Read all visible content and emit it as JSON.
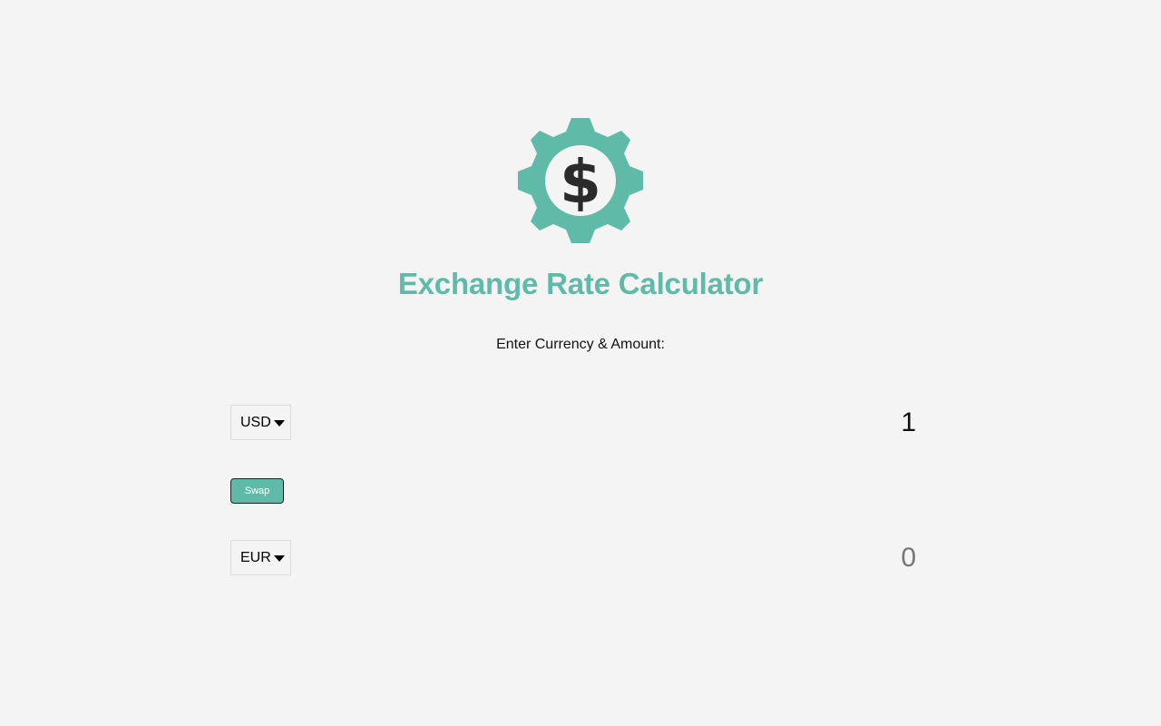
{
  "app": {
    "title": "Exchange Rate Calculator",
    "prompt": "Enter Currency & Amount:",
    "logo_icon": "gear-dollar-icon"
  },
  "converter": {
    "currency_one": "USD",
    "amount_one": "1",
    "swap_label": "Swap",
    "currency_two": "EUR",
    "amount_two": "0"
  },
  "colors": {
    "accent": "#5fbaa7",
    "background": "#f4f4f4",
    "dark": "#2b2b2b"
  }
}
